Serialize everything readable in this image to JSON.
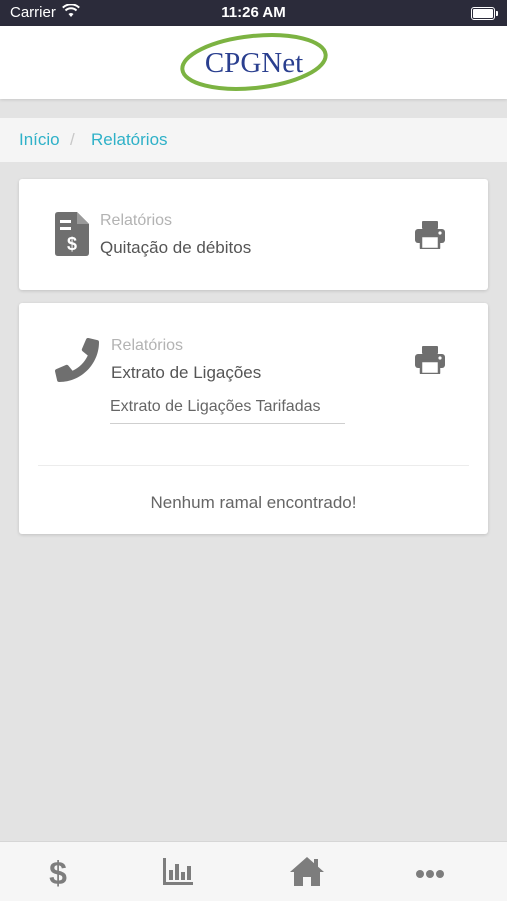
{
  "status_bar": {
    "carrier": "Carrier",
    "time": "11:26 AM"
  },
  "header": {
    "logo_text": "CPGNet"
  },
  "breadcrumb": {
    "items": [
      "Início",
      "Relatórios"
    ],
    "separator": "/"
  },
  "cards": [
    {
      "category": "Relatórios",
      "title": "Quitação de débitos",
      "icon": "invoice-dollar-icon",
      "action_icon": "print-icon"
    },
    {
      "category": "Relatórios",
      "title": "Extrato de Ligações",
      "icon": "phone-icon",
      "action_icon": "print-icon",
      "select_value": "Extrato de Ligações Tarifadas",
      "empty_message": "Nenhum ramal encontrado!"
    }
  ],
  "tab_bar": {
    "icons": [
      "dollar-icon",
      "bar-chart-icon",
      "home-icon",
      "more-icon"
    ]
  },
  "colors": {
    "accent": "#2fb1c8",
    "logo_green": "#7cb342",
    "logo_blue": "#2a3f8f",
    "icon_gray": "#6f6f6f"
  }
}
